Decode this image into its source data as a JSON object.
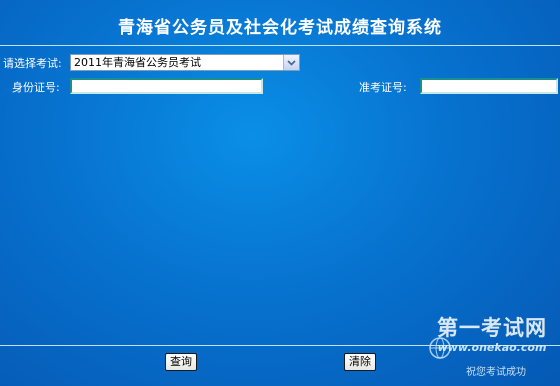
{
  "header": {
    "title": "青海省公务员及社会化考试成绩查询系统"
  },
  "form": {
    "exam_label": "请选择考试:",
    "exam_selected": "2011年青海省公务员考试",
    "id_label": "身份证号:",
    "id_value": "",
    "ticket_label": "准考证号:",
    "ticket_value": ""
  },
  "actions": {
    "query_label": "查询",
    "clear_label": "清除"
  },
  "watermark": {
    "site_name": "第一考试网",
    "url": "www.onekao.com",
    "slogan": "祝您考试成功"
  },
  "icons": {
    "dropdown": "chevron-down-icon",
    "logo": "globe-icon"
  },
  "colors": {
    "background": "#0772cf",
    "title": "#ffffff",
    "divider": "#bfe2ff"
  }
}
